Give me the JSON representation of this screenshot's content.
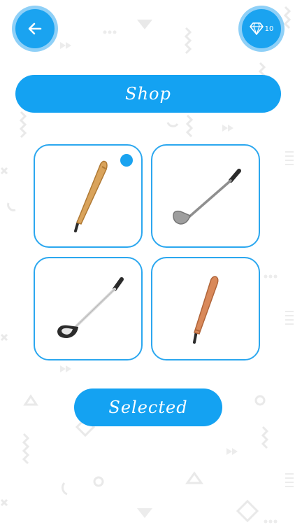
{
  "header": {
    "back_icon": "arrow-left-icon",
    "gems": {
      "icon": "diamond-icon",
      "count": "10"
    }
  },
  "shop": {
    "title": "Shop"
  },
  "items": [
    {
      "icon": "baseball-bat-icon",
      "selected": true
    },
    {
      "icon": "golf-putter-icon",
      "selected": false
    },
    {
      "icon": "golf-driver-icon",
      "selected": false
    },
    {
      "icon": "baseball-bat-icon",
      "selected": false
    }
  ],
  "footer": {
    "selected_label": "Selected"
  },
  "colors": {
    "accent": "#1aa3f0",
    "accent_light": "#8fd0f7",
    "card_border": "#2ba7ef"
  }
}
